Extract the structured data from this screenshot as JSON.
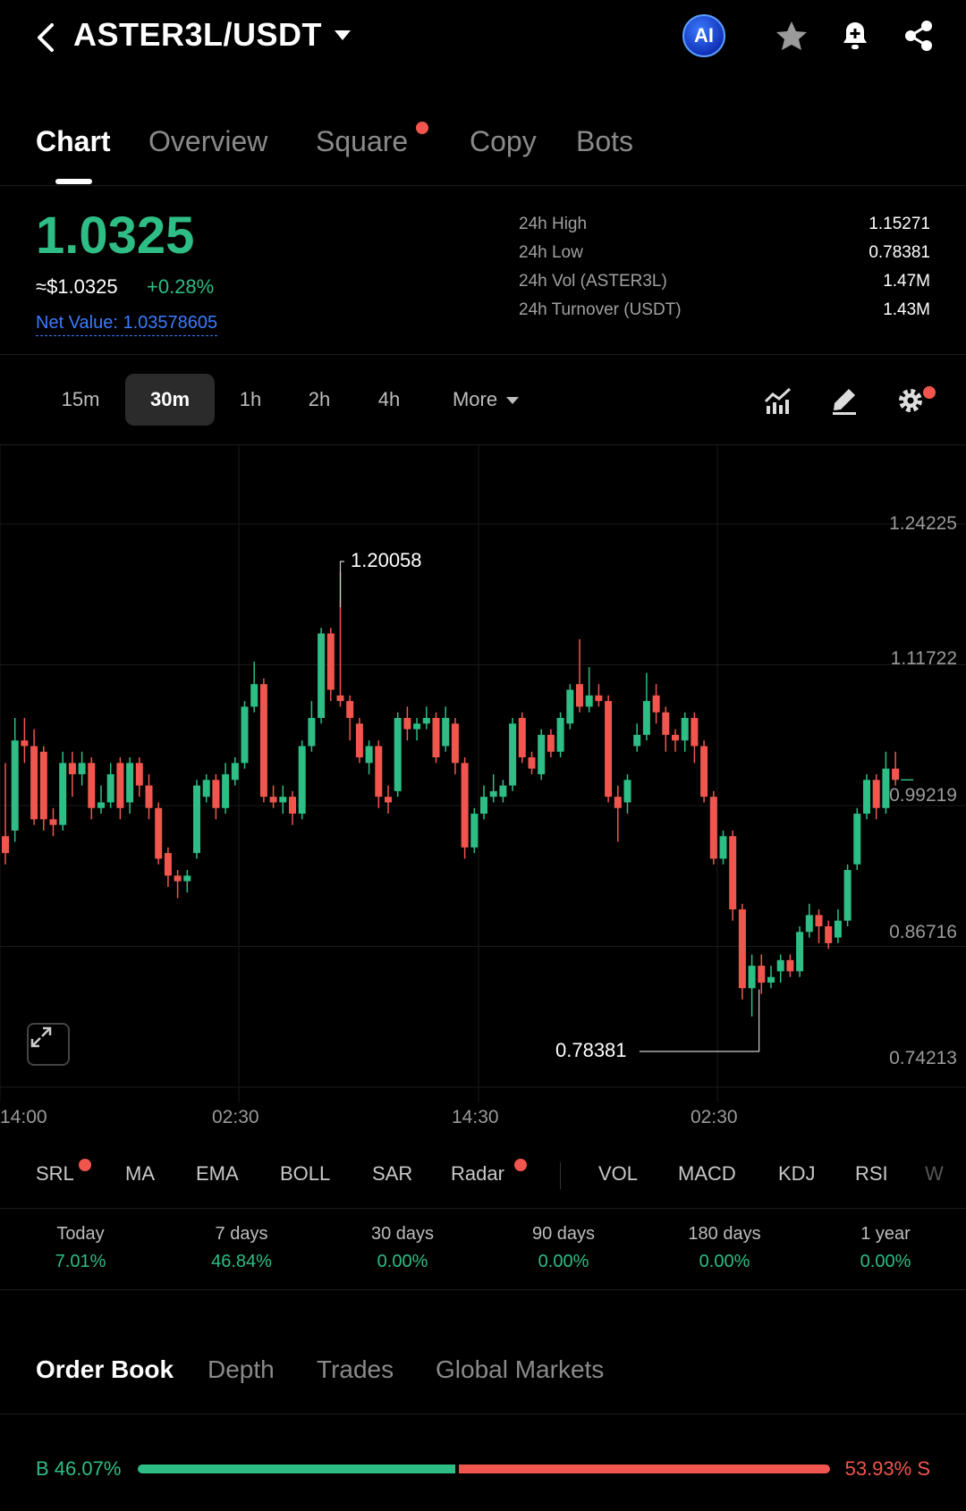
{
  "header": {
    "pair": "ASTER3L/USDT",
    "ai_label": "AI"
  },
  "tabs": [
    {
      "label": "Chart",
      "active": true
    },
    {
      "label": "Overview"
    },
    {
      "label": "Square",
      "dot": true
    },
    {
      "label": "Copy"
    },
    {
      "label": "Bots"
    }
  ],
  "price": {
    "last": "1.0325",
    "fiat": "≈$1.0325",
    "change": "+0.28%",
    "net_value": "Net Value: 1.03578605"
  },
  "stats": [
    {
      "label": "24h High",
      "value": "1.15271"
    },
    {
      "label": "24h Low",
      "value": "0.78381"
    },
    {
      "label": "24h Vol (ASTER3L)",
      "value": "1.47M"
    },
    {
      "label": "24h Turnover (USDT)",
      "value": "1.43M"
    }
  ],
  "intervals": {
    "items": [
      "15m",
      "30m",
      "1h",
      "2h",
      "4h"
    ],
    "active": "30m",
    "more_label": "More"
  },
  "colors": {
    "up": "#2ebd85",
    "down": "#f0564e",
    "accent_blue": "#3b7bff"
  },
  "chart_data": {
    "type": "candlestick",
    "y_ticks": [
      "1.24225",
      "1.11722",
      "0.99219",
      "0.86716",
      "0.74213"
    ],
    "x_ticks": [
      "14:00",
      "02:30",
      "14:30",
      "02:30"
    ],
    "ylim": [
      0.74213,
      1.24225
    ],
    "max_label": "1.20058",
    "min_label": "0.78381",
    "candles": [
      [
        0.965,
        0.95,
        1.03,
        0.94
      ],
      [
        0.97,
        1.05,
        1.07,
        0.96
      ],
      [
        1.05,
        1.045,
        1.07,
        1.03
      ],
      [
        1.045,
        0.98,
        1.06,
        0.975
      ],
      [
        1.04,
        0.98,
        1.045,
        0.97
      ],
      [
        0.98,
        0.975,
        0.99,
        0.965
      ],
      [
        0.975,
        1.03,
        1.04,
        0.97
      ],
      [
        1.03,
        1.02,
        1.04,
        1.0
      ],
      [
        1.02,
        1.03,
        1.04,
        1.01
      ],
      [
        1.03,
        0.99,
        1.035,
        0.98
      ],
      [
        0.99,
        0.995,
        1.01,
        0.985
      ],
      [
        0.995,
        1.02,
        1.03,
        0.99
      ],
      [
        1.03,
        0.99,
        1.035,
        0.98
      ],
      [
        0.995,
        1.03,
        1.035,
        0.985
      ],
      [
        1.03,
        1.01,
        1.035,
        1.0
      ],
      [
        1.01,
        0.99,
        1.02,
        0.98
      ],
      [
        0.99,
        0.945,
        0.995,
        0.94
      ],
      [
        0.95,
        0.93,
        0.955,
        0.92
      ],
      [
        0.93,
        0.925,
        0.935,
        0.91
      ],
      [
        0.925,
        0.93,
        0.935,
        0.915
      ],
      [
        0.95,
        1.01,
        1.015,
        0.945
      ],
      [
        1.0,
        1.015,
        1.02,
        0.995
      ],
      [
        1.015,
        0.99,
        1.02,
        0.98
      ],
      [
        0.99,
        1.02,
        1.03,
        0.985
      ],
      [
        1.015,
        1.03,
        1.035,
        1.01
      ],
      [
        1.03,
        1.08,
        1.085,
        1.025
      ],
      [
        1.08,
        1.1,
        1.12,
        1.075
      ],
      [
        1.1,
        1.0,
        1.105,
        0.995
      ],
      [
        1.0,
        0.995,
        1.01,
        0.99
      ],
      [
        0.995,
        1.0,
        1.01,
        0.985
      ],
      [
        1.0,
        0.985,
        1.005,
        0.975
      ],
      [
        0.985,
        1.045,
        1.05,
        0.98
      ],
      [
        1.045,
        1.07,
        1.085,
        1.04
      ],
      [
        1.07,
        1.145,
        1.15,
        1.065
      ],
      [
        1.145,
        1.095,
        1.15,
        1.085
      ],
      [
        1.09,
        1.085,
        1.2,
        1.08
      ],
      [
        1.085,
        1.07,
        1.09,
        1.05
      ],
      [
        1.065,
        1.035,
        1.07,
        1.03
      ],
      [
        1.03,
        1.045,
        1.05,
        1.02
      ],
      [
        1.045,
        1.0,
        1.05,
        0.99
      ],
      [
        1.0,
        0.995,
        1.01,
        0.985
      ],
      [
        1.005,
        1.07,
        1.075,
        1.0
      ],
      [
        1.07,
        1.06,
        1.08,
        1.05
      ],
      [
        1.06,
        1.065,
        1.07,
        1.05
      ],
      [
        1.065,
        1.07,
        1.08,
        1.06
      ],
      [
        1.07,
        1.035,
        1.075,
        1.03
      ],
      [
        1.045,
        1.07,
        1.08,
        1.04
      ],
      [
        1.065,
        1.03,
        1.07,
        1.02
      ],
      [
        1.03,
        0.955,
        1.035,
        0.945
      ],
      [
        0.955,
        0.985,
        0.99,
        0.95
      ],
      [
        0.985,
        1.0,
        1.01,
        0.98
      ],
      [
        1.0,
        1.005,
        1.02,
        0.995
      ],
      [
        1.0,
        1.01,
        1.015,
        0.995
      ],
      [
        1.01,
        1.065,
        1.07,
        1.005
      ],
      [
        1.07,
        1.035,
        1.075,
        1.03
      ],
      [
        1.035,
        1.025,
        1.04,
        1.02
      ],
      [
        1.02,
        1.055,
        1.06,
        1.015
      ],
      [
        1.055,
        1.04,
        1.06,
        1.035
      ],
      [
        1.04,
        1.07,
        1.075,
        1.035
      ],
      [
        1.065,
        1.095,
        1.1,
        1.06
      ],
      [
        1.1,
        1.08,
        1.14,
        1.075
      ],
      [
        1.08,
        1.09,
        1.115,
        1.075
      ],
      [
        1.09,
        1.085,
        1.1,
        1.08
      ],
      [
        1.085,
        1.0,
        1.09,
        0.995
      ],
      [
        1.0,
        0.99,
        1.01,
        0.96
      ],
      [
        0.995,
        1.015,
        1.02,
        0.985
      ],
      [
        1.045,
        1.055,
        1.065,
        1.04
      ],
      [
        1.055,
        1.085,
        1.11,
        1.05
      ],
      [
        1.09,
        1.075,
        1.1,
        1.065
      ],
      [
        1.075,
        1.055,
        1.08,
        1.04
      ],
      [
        1.055,
        1.05,
        1.06,
        1.04
      ],
      [
        1.05,
        1.07,
        1.075,
        1.04
      ],
      [
        1.07,
        1.045,
        1.075,
        1.03
      ],
      [
        1.045,
        1.0,
        1.05,
        0.995
      ],
      [
        1.0,
        0.945,
        1.005,
        0.94
      ],
      [
        0.945,
        0.965,
        0.97,
        0.94
      ],
      [
        0.965,
        0.9,
        0.97,
        0.89
      ],
      [
        0.9,
        0.83,
        0.905,
        0.82
      ],
      [
        0.83,
        0.85,
        0.86,
        0.805
      ],
      [
        0.85,
        0.835,
        0.86,
        0.825
      ],
      [
        0.835,
        0.84,
        0.85,
        0.83
      ],
      [
        0.845,
        0.855,
        0.86,
        0.835
      ],
      [
        0.855,
        0.845,
        0.86,
        0.84
      ],
      [
        0.845,
        0.88,
        0.885,
        0.84
      ],
      [
        0.88,
        0.895,
        0.905,
        0.875
      ],
      [
        0.895,
        0.885,
        0.9,
        0.87
      ],
      [
        0.885,
        0.87,
        0.89,
        0.865
      ],
      [
        0.875,
        0.89,
        0.9,
        0.87
      ],
      [
        0.89,
        0.935,
        0.94,
        0.885
      ],
      [
        0.94,
        0.985,
        0.99,
        0.935
      ],
      [
        0.985,
        1.015,
        1.02,
        0.98
      ],
      [
        1.015,
        0.99,
        1.02,
        0.98
      ],
      [
        0.99,
        1.025,
        1.04,
        0.985
      ],
      [
        1.025,
        1.015,
        1.04,
        1.01
      ]
    ]
  },
  "indicators": {
    "main": [
      {
        "label": "SRL",
        "dot": true
      },
      {
        "label": "MA"
      },
      {
        "label": "EMA"
      },
      {
        "label": "BOLL"
      },
      {
        "label": "SAR"
      },
      {
        "label": "Radar",
        "dot": true
      }
    ],
    "sub": [
      "VOL",
      "MACD",
      "KDJ",
      "RSI",
      "W"
    ]
  },
  "returns": [
    {
      "label": "Today",
      "value": "7.01%"
    },
    {
      "label": "7 days",
      "value": "46.84%"
    },
    {
      "label": "30 days",
      "value": "0.00%"
    },
    {
      "label": "90 days",
      "value": "0.00%"
    },
    {
      "label": "180 days",
      "value": "0.00%"
    },
    {
      "label": "1 year",
      "value": "0.00%"
    }
  ],
  "bottom_tabs": [
    {
      "label": "Order Book",
      "active": true
    },
    {
      "label": "Depth"
    },
    {
      "label": "Trades"
    },
    {
      "label": "Global Markets"
    }
  ],
  "ratio": {
    "buy_label": "B 46.07%",
    "sell_label": "53.93% S",
    "buy_fraction": 0.4607
  }
}
